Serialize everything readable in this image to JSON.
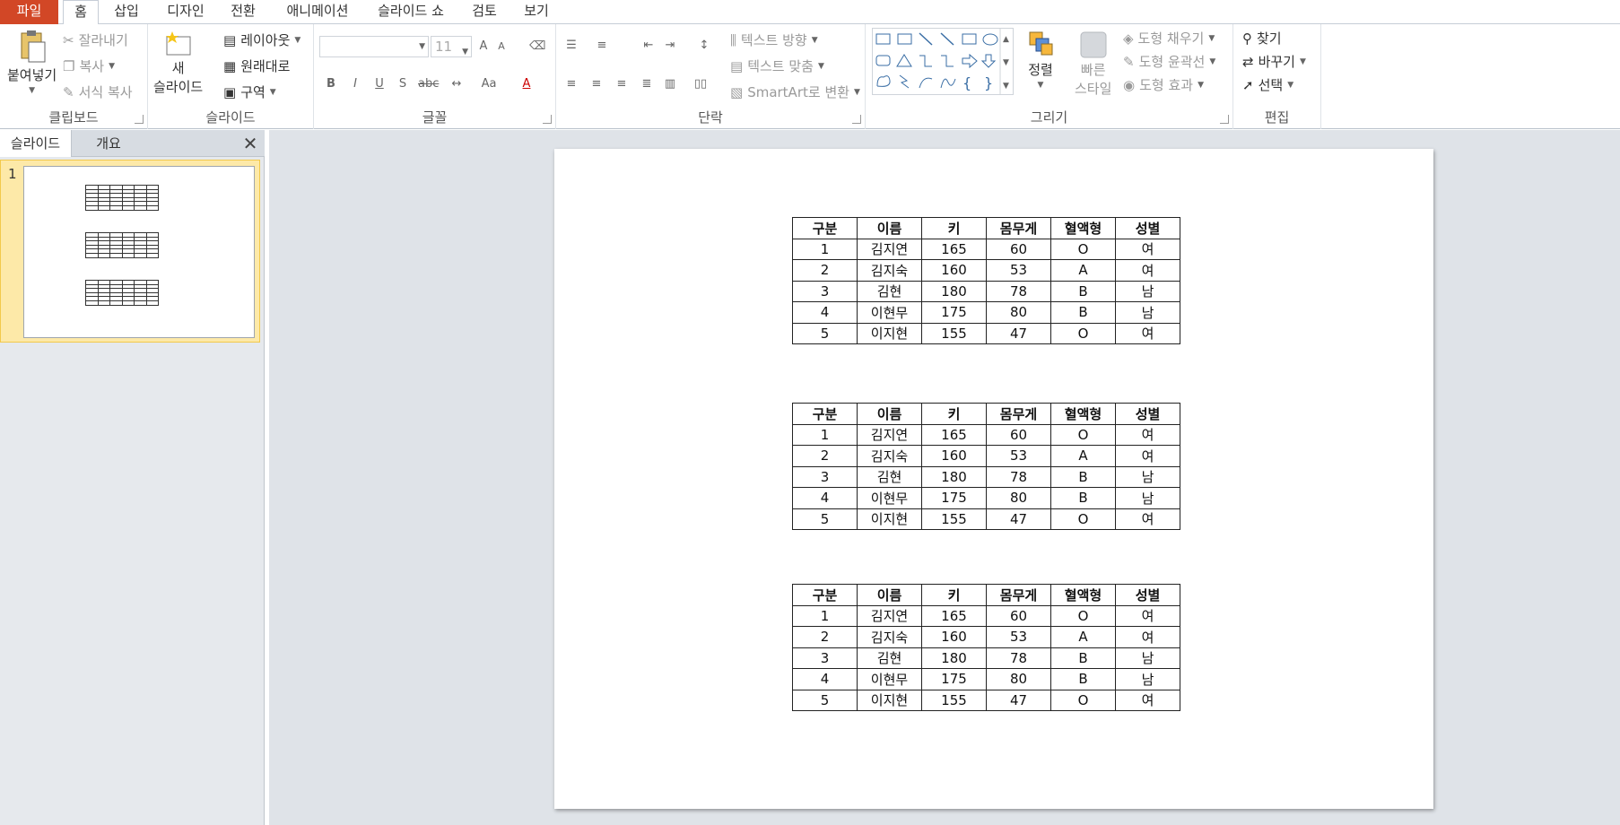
{
  "tabs": {
    "file": "파일",
    "items": [
      "홈",
      "삽입",
      "디자인",
      "전환",
      "애니메이션",
      "슬라이드 쇼",
      "검토",
      "보기"
    ]
  },
  "ribbon": {
    "clipboard": {
      "paste": "붙여넣기",
      "cut": "잘라내기",
      "copy": "복사",
      "format_painter": "서식 복사",
      "label": "클립보드"
    },
    "slides": {
      "new_line1": "새",
      "new_line2": "슬라이드",
      "layout": "레이아웃",
      "reset": "원래대로",
      "section": "구역",
      "label": "슬라이드"
    },
    "font": {
      "size": "11",
      "label": "글꼴"
    },
    "paragraph": {
      "text_direction": "텍스트 방향",
      "align_text": "텍스트 맞춤",
      "smartart": "SmartArt로 변환",
      "label": "단락"
    },
    "drawing": {
      "arrange": "정렬",
      "quick_line1": "빠른",
      "quick_line2": "스타일",
      "fill": "도형 채우기",
      "outline": "도형 윤곽선",
      "effects": "도형 효과",
      "label": "그리기"
    },
    "editing": {
      "find": "찾기",
      "replace": "바꾸기",
      "select": "선택",
      "label": "편집"
    }
  },
  "pane": {
    "tab_slides": "슬라이드",
    "tab_outline": "개요",
    "slide_number": "1"
  },
  "table": {
    "headers": [
      "구분",
      "이름",
      "키",
      "몸무게",
      "혈액형",
      "성별"
    ],
    "rows": [
      [
        "1",
        "김지연",
        "165",
        "60",
        "O",
        "여"
      ],
      [
        "2",
        "김지숙",
        "160",
        "53",
        "A",
        "여"
      ],
      [
        "3",
        "김현",
        "180",
        "78",
        "B",
        "남"
      ],
      [
        "4",
        "이현무",
        "175",
        "80",
        "B",
        "남"
      ],
      [
        "5",
        "이지현",
        "155",
        "47",
        "O",
        "여"
      ]
    ]
  }
}
